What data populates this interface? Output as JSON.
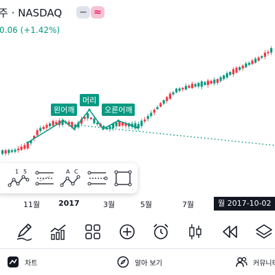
{
  "header": {
    "ticker": "주 · NASDAQ",
    "change": "0.06 (+1.42%)",
    "minus_label": "−",
    "approx_label": "≈"
  },
  "patterns": {
    "left_shoulder": "왼어깨",
    "head": "머리",
    "right_shoulder": "오른어깨"
  },
  "drawing_tools": [
    {
      "name": "five-point-pattern",
      "labels": [
        "1",
        "5"
      ]
    },
    {
      "name": "lines-tool"
    },
    {
      "name": "abcd-pattern",
      "labels": [
        "A",
        "C"
      ]
    },
    {
      "name": "projection-tool"
    },
    {
      "name": "rectangle-tool"
    }
  ],
  "xaxis": {
    "labels": [
      "11월",
      "2017",
      "3월",
      "5월",
      "7월"
    ],
    "crosshair": "월 2017-10-02"
  },
  "toolbar": [
    "pencil-icon",
    "indicators-icon",
    "templates-icon",
    "add-icon",
    "alert-icon",
    "chart-type-icon",
    "replay-icon",
    "layers-icon"
  ],
  "bottom_nav": {
    "chart": "차트",
    "explore": "알아 보기",
    "community": "커뮤니티"
  },
  "colors": {
    "up": "#089981",
    "down": "#f23645",
    "text": "#131722",
    "accent_pink": "#e91e63"
  }
}
